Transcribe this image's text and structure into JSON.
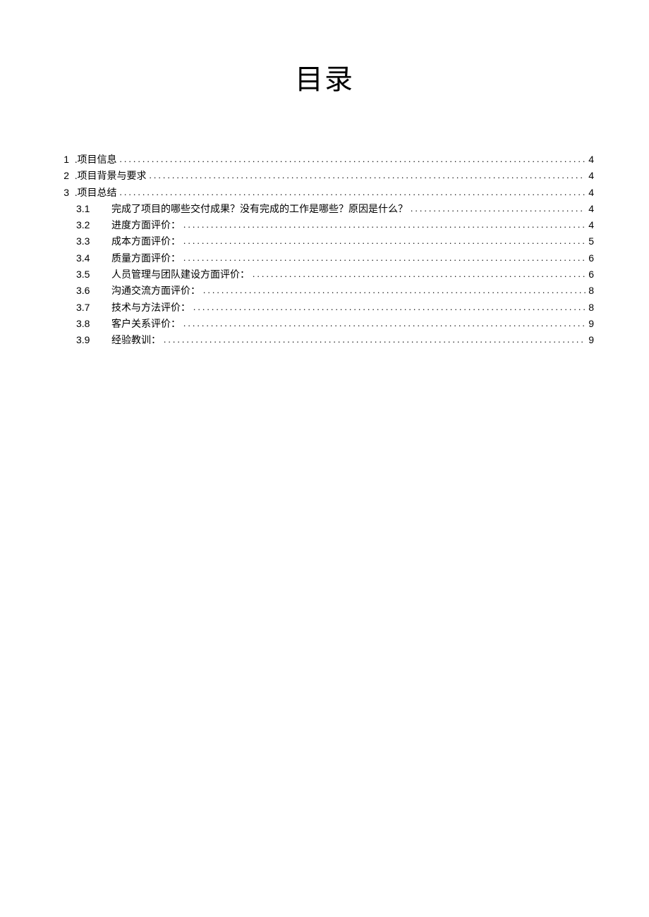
{
  "title": "目录",
  "toc": [
    {
      "level": 1,
      "num": "1",
      "prefix": ".",
      "label": "项目信息",
      "page": "4"
    },
    {
      "level": 1,
      "num": "2",
      "prefix": ".",
      "label": "项目背景与要求",
      "page": "4"
    },
    {
      "level": 1,
      "num": "3",
      "prefix": ".",
      "label": "项目总结",
      "page": "4"
    },
    {
      "level": 2,
      "num": "3.1",
      "label": "完成了项目的哪些交付成果？没有完成的工作是哪些？原因是什么？",
      "page": "4"
    },
    {
      "level": 2,
      "num": "3.2",
      "label": "进度方面评价：",
      "page": "4"
    },
    {
      "level": 2,
      "num": "3.3",
      "label": "成本方面评价：",
      "page": "5"
    },
    {
      "level": 2,
      "num": "3.4",
      "label": "质量方面评价：",
      "page": "6"
    },
    {
      "level": 2,
      "num": "3.5",
      "label": "人员管理与团队建设方面评价：",
      "page": "6"
    },
    {
      "level": 2,
      "num": "3.6",
      "label": "沟通交流方面评价：",
      "page": "8"
    },
    {
      "level": 2,
      "num": "3.7",
      "label": "技术与方法评价：",
      "page": "8"
    },
    {
      "level": 2,
      "num": "3.8",
      "label": "客户关系评价：",
      "page": "9"
    },
    {
      "level": 2,
      "num": "3.9",
      "label": "经验教训：",
      "page": "9"
    }
  ]
}
